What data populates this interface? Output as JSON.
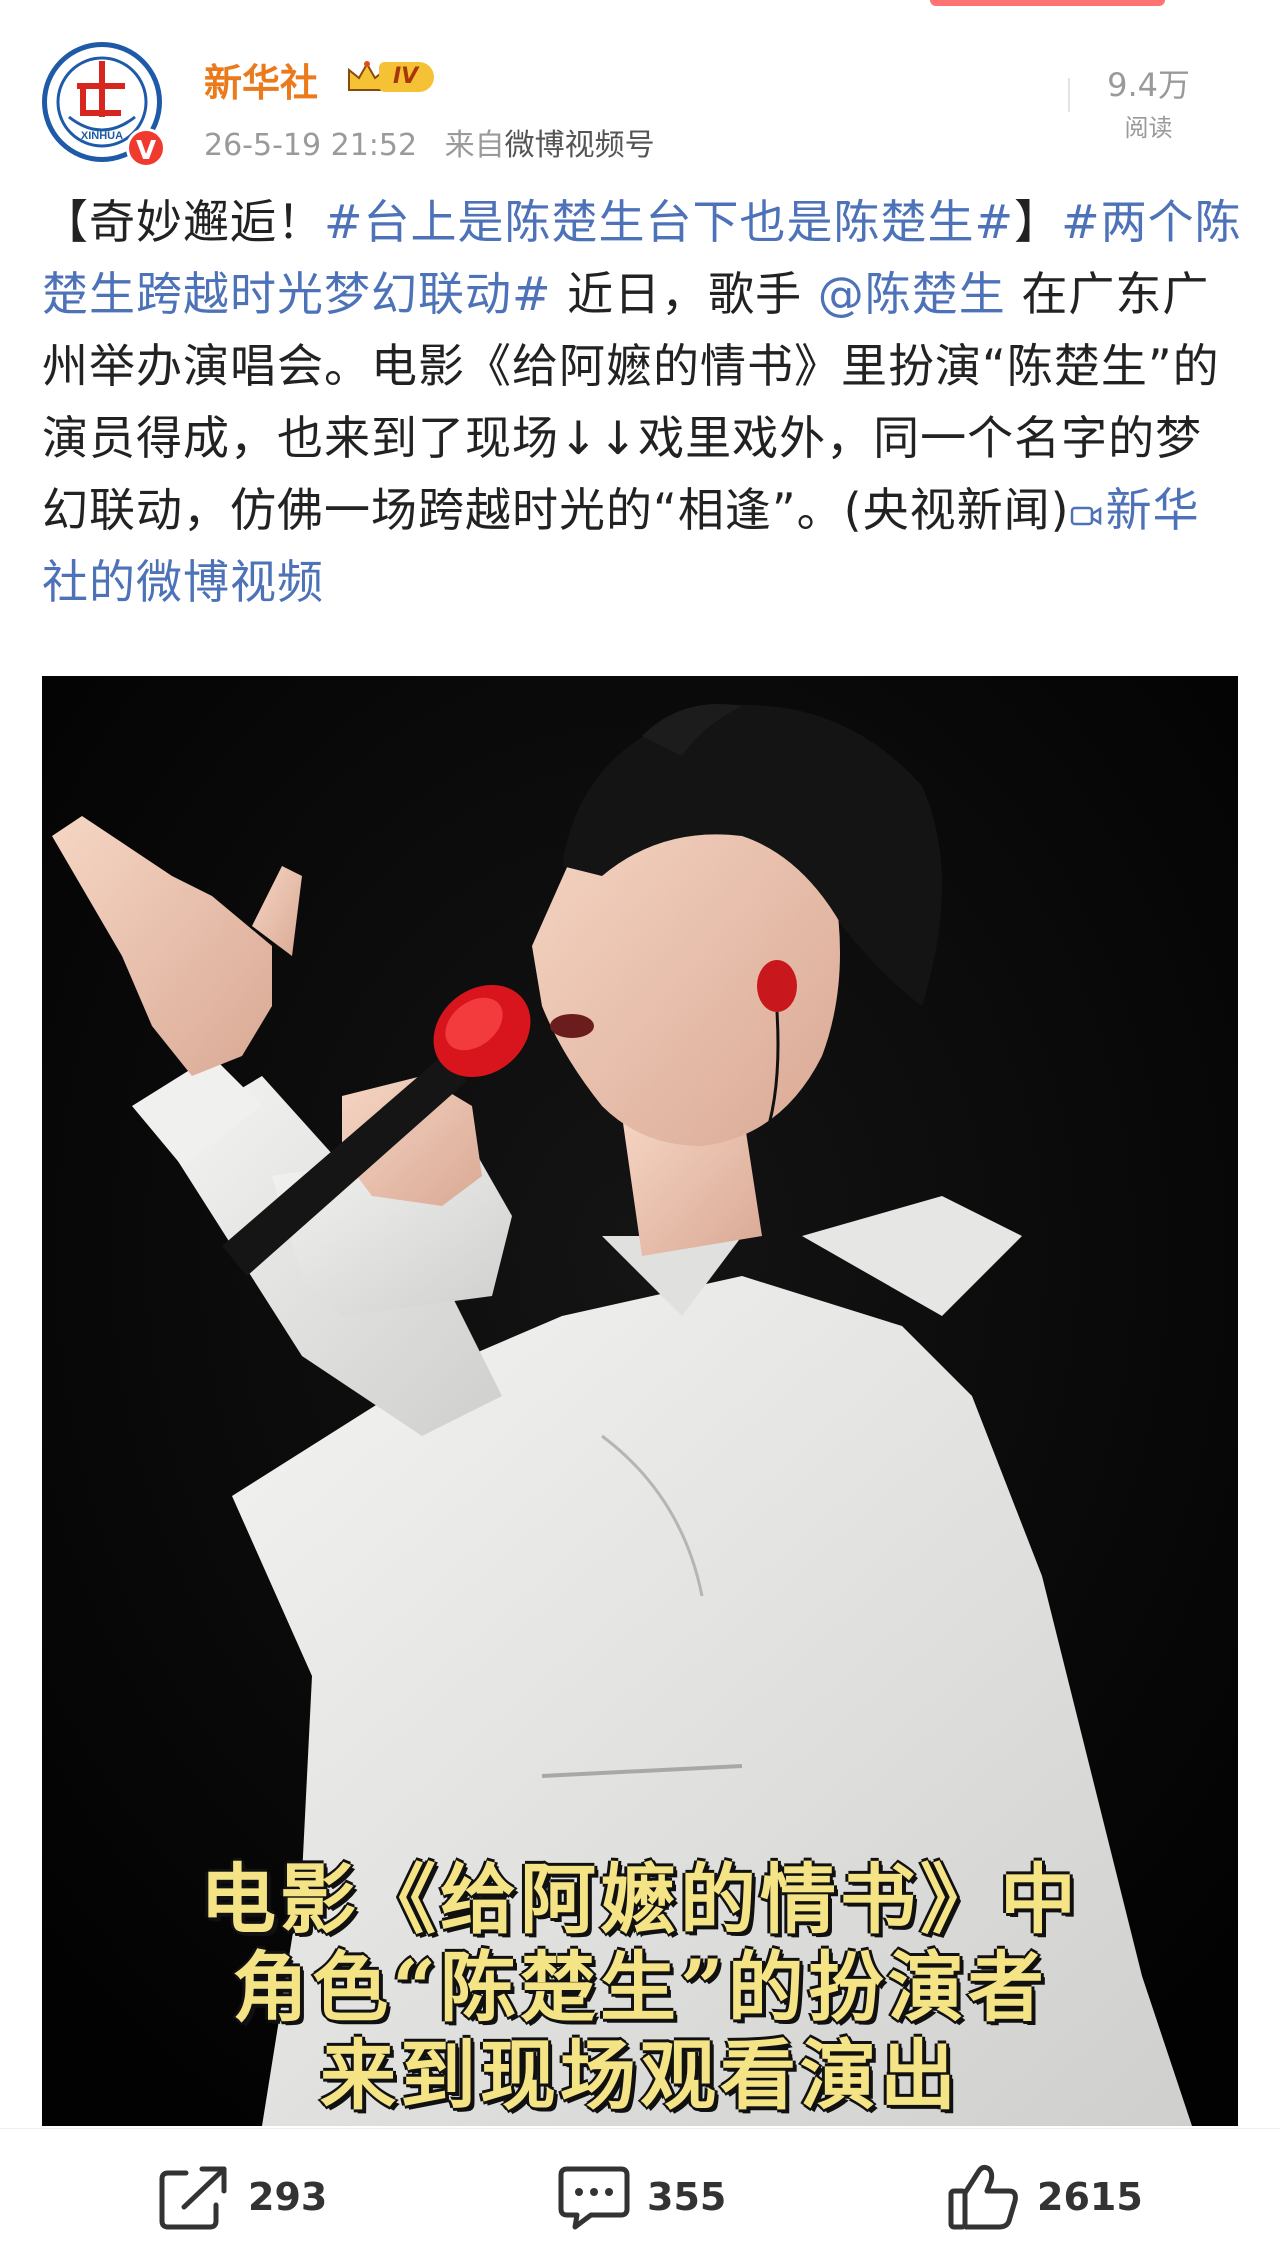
{
  "post": {
    "author": "新华社",
    "level_badge": "IV",
    "verified_badge": "V",
    "avatar_text": "XINHUA",
    "time": "26-5-19 21:52",
    "source_prefix": "来自",
    "source": "微博视频号",
    "views_count": "9.4万",
    "views_label": "阅读",
    "text": {
      "p1": "【奇妙邂逅！",
      "hashtag1": "#台上是陈楚生台下也是陈楚生#",
      "p2": "】",
      "hashtag2": "#两个陈楚生跨越时光梦幻联动#",
      "p3": " 近日，歌手 ",
      "mention": "@陈楚生",
      "p4": " 在广东广州举办演唱会。电影《给阿嬷的情书》里扮演“陈楚生”的演员得成，也来到了现场↓↓戏里戏外，同一个名字的梦幻联动，仿佛一场跨越时光的“相逢”。(央视新闻)",
      "video_link": "新华社的微博视频"
    }
  },
  "video": {
    "subtitle_lines": [
      "电影《给阿嬷的情书》中",
      "角色“陈楚生”的扮演者",
      "来到现场观看演出"
    ]
  },
  "actions": {
    "share_count": "293",
    "comment_count": "355",
    "like_count": "2615"
  },
  "colors": {
    "author": "#ea7a1b",
    "link": "#4d72b8",
    "subtitle": "#f4e486",
    "verified": "#f03a2e"
  }
}
